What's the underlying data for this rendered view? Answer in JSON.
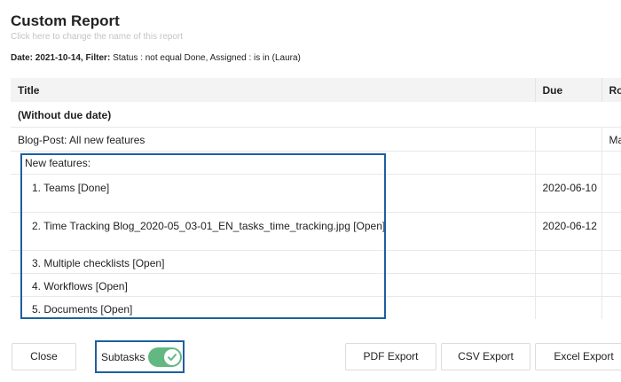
{
  "report": {
    "title": "Custom Report",
    "rename_hint": "Click here to change the name of this report",
    "filter_prefix": "Date: 2021-10-14, Filter:",
    "filter_text": "Status : not equal Done, Assigned : is in (Laura)"
  },
  "table": {
    "headers": [
      "Title",
      "Due",
      "Ro"
    ],
    "group_label": "(Without due date)",
    "parent": {
      "title": "Blog-Post: All new features",
      "due": "",
      "extra": "Ma"
    },
    "section_label": "New features:",
    "rows": [
      {
        "title": "1. Teams [Done]",
        "due": "2020-06-10"
      },
      {
        "title": "2. Time Tracking Blog_2020-05_03-01_EN_tasks_time_tracking.jpg [Open]",
        "due": "2020-06-12"
      },
      {
        "title": "3. Multiple checklists [Open]",
        "due": ""
      },
      {
        "title": "4. Workflows [Open]",
        "due": ""
      },
      {
        "title": "5. Documents [Open]",
        "due": ""
      }
    ]
  },
  "footer": {
    "close_label": "Close",
    "subtasks_label": "Subtasks",
    "subtasks_enabled": true,
    "toggle_color": "#62b881",
    "pdf_label": "PDF Export",
    "csv_label": "CSV Export",
    "excel_label": "Excel Export"
  },
  "colors": {
    "highlight_border": "#1e5fa0",
    "header_bg": "#f3f3f3"
  }
}
